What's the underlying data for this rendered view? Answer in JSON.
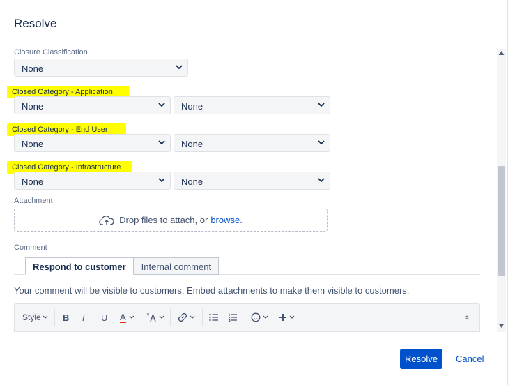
{
  "dialog": {
    "title": "Resolve"
  },
  "closure_classification": {
    "label": "Closure Classification",
    "value": "None"
  },
  "closed_category_application": {
    "label": "Closed Category - Application",
    "value_1": "None",
    "value_2": "None"
  },
  "closed_category_end_user": {
    "label": "Closed Category - End User",
    "value_1": "None",
    "value_2": "None"
  },
  "closed_category_infrastructure": {
    "label": "Closed Category - Infrastructure",
    "value_1": "None",
    "value_2": "None"
  },
  "attachment": {
    "label": "Attachment",
    "drop_text": "Drop files to attach, or",
    "browse_text": "browse."
  },
  "comment": {
    "label": "Comment",
    "tabs": [
      {
        "label": "Respond to customer"
      },
      {
        "label": "Internal comment"
      }
    ],
    "hint": "Your comment will be visible to customers. Embed attachments to make them visible to customers.",
    "toolbar": {
      "style_label": "Style",
      "bold": "B",
      "italic": "I",
      "underline": "U",
      "text_color": "A"
    }
  },
  "colors": {
    "highlight": "#ffff00",
    "primary": "#0052cc",
    "text_color_underline": "#de350b"
  },
  "footer": {
    "resolve_label": "Resolve",
    "cancel_label": "Cancel"
  }
}
